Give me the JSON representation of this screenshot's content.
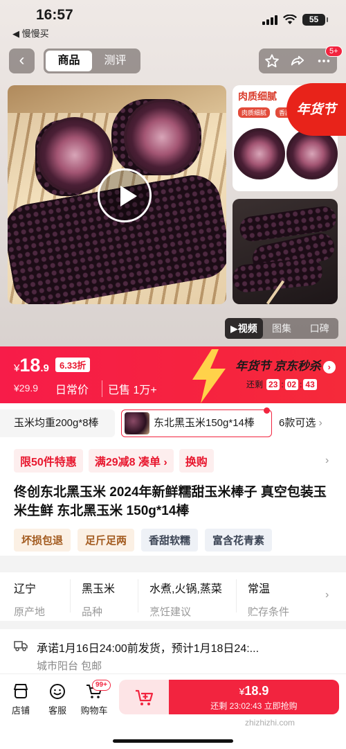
{
  "status": {
    "time": "16:57",
    "back_app": "◀ 慢慢买",
    "battery": "55"
  },
  "nav": {
    "tabs": [
      "商品",
      "测评"
    ],
    "badge": "5+"
  },
  "gallery": {
    "side_title": "肉质细腻",
    "side_chips": [
      "肉质细腻",
      "香甜"
    ],
    "promo_stamp": "年货节",
    "media_tabs": [
      "▶视频",
      "图集",
      "口碑"
    ]
  },
  "price": {
    "currency": "¥",
    "integer": "18",
    "decimal": ".9",
    "discount": "6.33折",
    "original": "¥29.9",
    "daily_label": "日常价",
    "sold": "已售 1万+"
  },
  "seckill": {
    "label": "年货节 京东秒杀",
    "countdown_label": "还剩",
    "countdown": [
      "23",
      "02",
      "43"
    ]
  },
  "specs": {
    "first": "玉米均重200g*8棒",
    "selected": "东北黑玉米150g*14棒",
    "more": "6款可选"
  },
  "promos": [
    "限50件特惠",
    "满29减8 凑单 ›",
    "换购"
  ],
  "title": "佟创东北黑玉米 2024年新鲜糯甜玉米棒子 真空包装玉米生鲜 东北黑玉米 150g*14棒",
  "tags": [
    "坏损包退",
    "足斤足两",
    "香甜软糯",
    "富含花青素"
  ],
  "attributes": [
    {
      "value": "辽宁",
      "key": "原产地"
    },
    {
      "value": "黑玉米",
      "key": "品种"
    },
    {
      "value": "水煮,火锅,蒸菜",
      "key": "烹饪建议"
    },
    {
      "value": "常温",
      "key": "贮存条件"
    }
  ],
  "shipping": {
    "promise": "承诺1月16日24:00前发货，预计1月18日24:...",
    "location": "城市阳台  包邮"
  },
  "bottom": {
    "shop": "店铺",
    "service": "客服",
    "cart": "购物车",
    "cart_badge": "99+",
    "buy_price_currency": "¥",
    "buy_price": "18.9",
    "buy_countdown": "还剩 23:02:43 立即抢购"
  },
  "watermark": "zhizhizhi.com",
  "colors": {
    "accent": "#f2243f",
    "promo_bg": "#fdeeee"
  }
}
